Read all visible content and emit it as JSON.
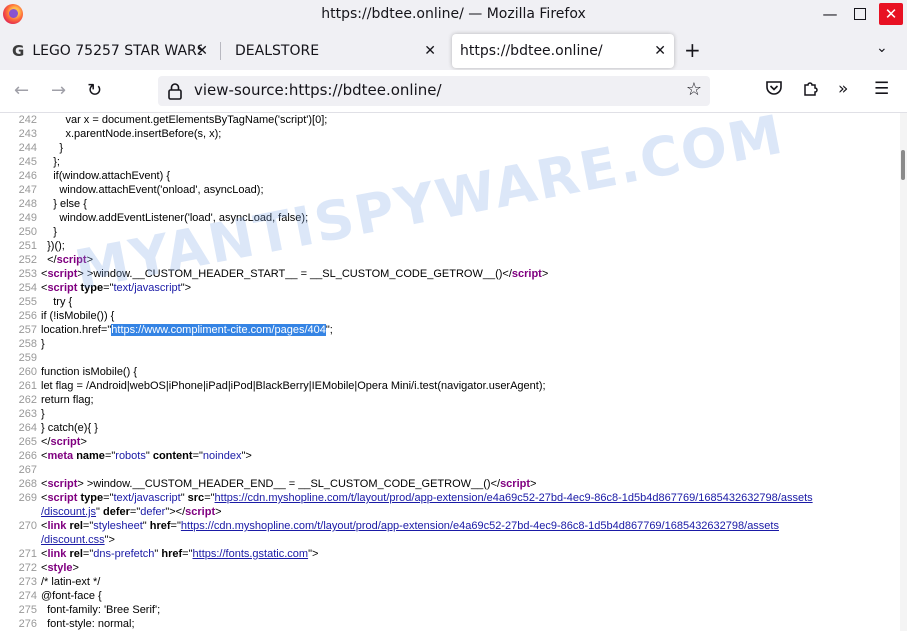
{
  "window": {
    "title": "https://bdtee.online/ — Mozilla Firefox"
  },
  "tabs": [
    {
      "label": "LEGO 75257 STAR WARS",
      "icon": "google-g-icon"
    },
    {
      "label": "DEALSTORE"
    },
    {
      "label": "https://bdtee.online/",
      "active": true
    }
  ],
  "address_bar": {
    "url": "view-source:https://bdtee.online/"
  },
  "watermark": "MYANTISPYWARE.COM",
  "colors": {
    "tag": "#800080",
    "attr_value": "#1a1aa6",
    "selection": "#3584e4",
    "close_button": "#e81123"
  },
  "source_lines": [
    {
      "n": "242",
      "text": "        var x = document.getElementsByTagName('script')[0];"
    },
    {
      "n": "243",
      "text": "        x.parentNode.insertBefore(s, x);"
    },
    {
      "n": "244",
      "text": "      }"
    },
    {
      "n": "245",
      "text": "    };"
    },
    {
      "n": "246",
      "text": "    if(window.attachEvent) {"
    },
    {
      "n": "247",
      "text": "      window.attachEvent('onload', asyncLoad);"
    },
    {
      "n": "248",
      "text": "    } else {"
    },
    {
      "n": "249",
      "text": "      window.addEventListener('load', asyncLoad, false);"
    },
    {
      "n": "250",
      "text": "    }"
    },
    {
      "n": "251",
      "text": "  })();"
    },
    {
      "n": "252",
      "pre": "  ",
      "close": "script"
    },
    {
      "n": "253",
      "tag": "script",
      "attrs": [],
      "text": " >window.__CUSTOM_HEADER_START__ = __SL_CUSTOM_CODE_GETROW__()",
      "close": "script"
    },
    {
      "n": "254",
      "tag": "script",
      "attrs": [
        {
          "name": "type",
          "value": "text/javascript"
        }
      ]
    },
    {
      "n": "255",
      "text": "    try {"
    },
    {
      "n": "256",
      "text": "if (!isMobile()) {"
    },
    {
      "n": "257",
      "text": "location.href=\"",
      "selected": "https://www.compliment-cite.com/pages/404",
      "after": "\";"
    },
    {
      "n": "258",
      "text": "}"
    },
    {
      "n": "259",
      "text": ""
    },
    {
      "n": "260",
      "text": "function isMobile() {"
    },
    {
      "n": "261",
      "text": "let flag = /Android|webOS|iPhone|iPad|iPod|BlackBerry|IEMobile|Opera Mini/i.test(navigator.userAgent);"
    },
    {
      "n": "262",
      "text": "return flag;"
    },
    {
      "n": "263",
      "text": "}"
    },
    {
      "n": "264",
      "text": "} catch(e){ }"
    },
    {
      "n": "265",
      "close": "script"
    },
    {
      "n": "266",
      "tag": "meta",
      "attrs": [
        {
          "name": "name",
          "value": "robots"
        },
        {
          "name": "content",
          "value": "noindex"
        }
      ]
    },
    {
      "n": "267",
      "text": ""
    },
    {
      "n": "268",
      "tag": "script",
      "attrs": [],
      "text": " >window.__CUSTOM_HEADER_END__ = __SL_CUSTOM_CODE_GETROW__()",
      "close": "script"
    },
    {
      "n": "269",
      "tag": "script",
      "attrs": [
        {
          "name": "type",
          "value": "text/javascript"
        },
        {
          "name": "src",
          "value": "https://cdn.myshopline.com/t/layout/prod/app-extension/e4a69c52-27bd-4ec9-86c8-1d5b4d867769/1685432632798/assets",
          "link": true
        }
      ]
    },
    {
      "n": "",
      "link_text": "/discount.js",
      "text_after": "\" ",
      "attrs2": [
        {
          "name": "defer",
          "value": "defer"
        }
      ],
      "close": "script"
    },
    {
      "n": "270",
      "tag": "link",
      "attrs": [
        {
          "name": "rel",
          "value": "stylesheet"
        },
        {
          "name": "href",
          "value": "https://cdn.myshopline.com/t/layout/prod/app-extension/e4a69c52-27bd-4ec9-86c8-1d5b4d867769/1685432632798/assets",
          "link": true
        }
      ]
    },
    {
      "n": "",
      "link_text": "/discount.css",
      "text_after": "\">"
    },
    {
      "n": "271",
      "tag": "link",
      "attrs": [
        {
          "name": "rel",
          "value": "dns-prefetch"
        },
        {
          "name": "href",
          "value": "https://fonts.gstatic.com",
          "link": true
        }
      ],
      "end": "\">"
    },
    {
      "n": "272",
      "tag": "style",
      "attrs": []
    },
    {
      "n": "273",
      "text": "/* latin-ext */"
    },
    {
      "n": "274",
      "text": "@font-face {"
    },
    {
      "n": "275",
      "text": "  font-family: 'Bree Serif';"
    },
    {
      "n": "276",
      "text": "  font-style: normal;"
    }
  ]
}
